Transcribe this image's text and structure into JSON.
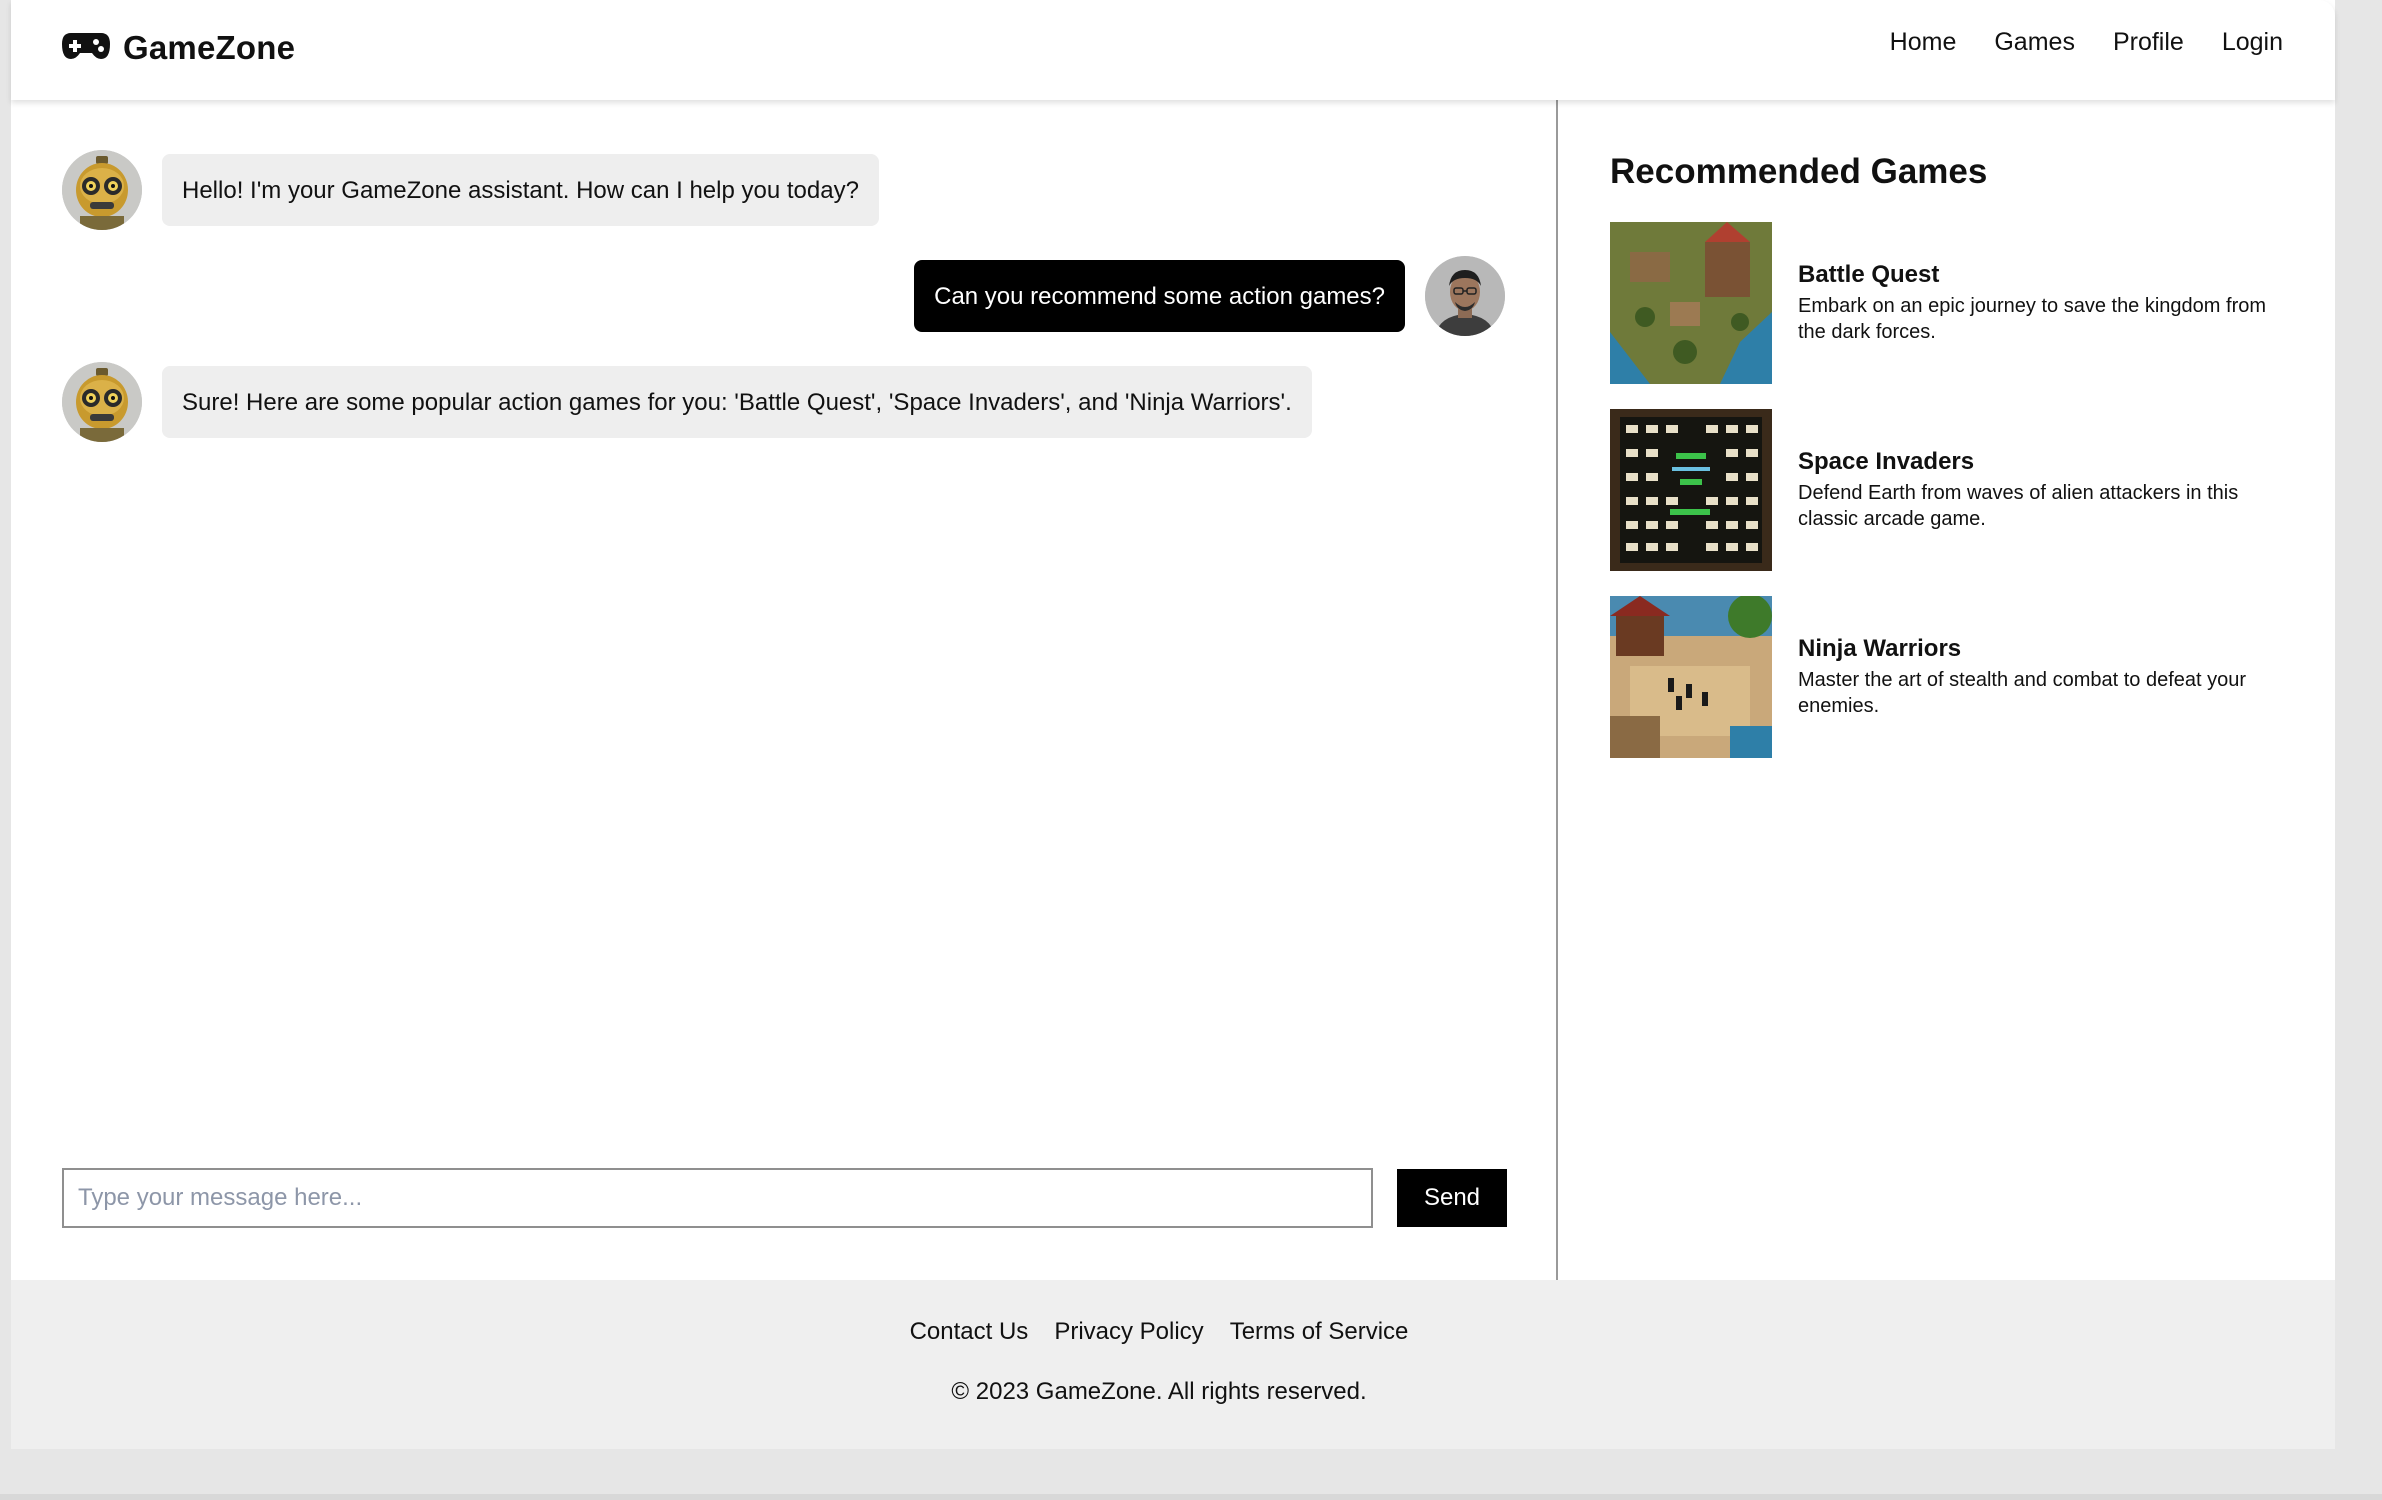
{
  "header": {
    "brand": "GameZone",
    "nav": [
      "Home",
      "Games",
      "Profile",
      "Login"
    ]
  },
  "chat": {
    "messages": [
      {
        "from": "bot",
        "text": "Hello! I'm your GameZone assistant. How can I help you today?"
      },
      {
        "from": "user",
        "text": "Can you recommend some action games?"
      },
      {
        "from": "bot",
        "text": "Sure! Here are some popular action games for you: 'Battle Quest', 'Space Invaders', and 'Ninja Warriors'."
      }
    ],
    "input_placeholder": "Type your message here...",
    "input_value": "",
    "send_label": "Send"
  },
  "recommended": {
    "title": "Recommended Games",
    "games": [
      {
        "name": "Battle Quest",
        "description": "Embark on an epic journey to save the kingdom from the dark forces."
      },
      {
        "name": "Space Invaders",
        "description": "Defend Earth from waves of alien attackers in this classic arcade game."
      },
      {
        "name": "Ninja Warriors",
        "description": "Master the art of stealth and combat to defeat your enemies."
      }
    ]
  },
  "footer": {
    "links": [
      "Contact Us",
      "Privacy Policy",
      "Terms of Service"
    ],
    "copyright": "© 2023 GameZone. All rights reserved."
  },
  "icons": {
    "brand": "gamepad-icon",
    "bot_avatar": "robot-avatar",
    "user_avatar": "user-avatar"
  },
  "colors": {
    "accent": "#000000",
    "bot_bubble": "#eeeeee",
    "footer_bg": "#efefef"
  }
}
